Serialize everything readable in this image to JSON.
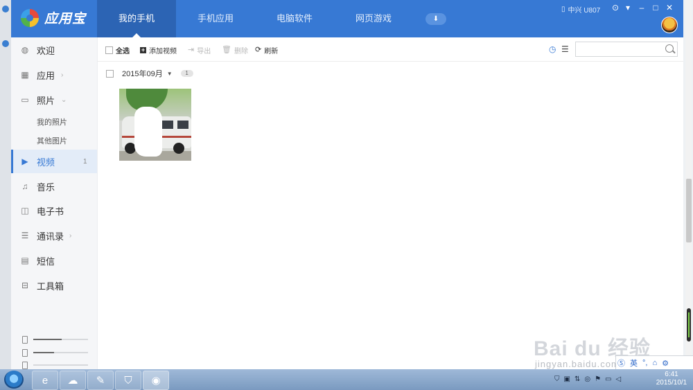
{
  "app": {
    "name": "应用宝",
    "tabs": [
      {
        "label": "我的手机"
      },
      {
        "label": "手机应用"
      },
      {
        "label": "电脑软件"
      },
      {
        "label": "网页游戏"
      }
    ],
    "device_name": "中兴 U807"
  },
  "sidebar": {
    "items": [
      {
        "label": "欢迎",
        "icon": "welcome-icon"
      },
      {
        "label": "应用",
        "icon": "apps-grid-icon"
      },
      {
        "label": "照片",
        "icon": "photo-icon"
      },
      {
        "label": "视频",
        "icon": "video-icon",
        "count": "1"
      },
      {
        "label": "音乐",
        "icon": "music-note-icon"
      },
      {
        "label": "电子书",
        "icon": "book-icon"
      },
      {
        "label": "通讯录",
        "icon": "contacts-icon"
      },
      {
        "label": "短信",
        "icon": "sms-icon"
      },
      {
        "label": "工具箱",
        "icon": "toolbox-icon"
      }
    ],
    "photo_sub": [
      "我的照片",
      "其他图片"
    ],
    "storage": [
      {
        "fill": 0.52
      },
      {
        "fill": 0.38
      },
      {
        "fill": 0.0
      }
    ]
  },
  "toolbar": {
    "select_all": "全选",
    "add_video": "添加视频",
    "export": "导出",
    "delete": "删除",
    "refresh": "刷新",
    "search_placeholder": ""
  },
  "content": {
    "group_label": "2015年09月",
    "group_count": "1"
  },
  "watermark": {
    "text": "Bai du 经验",
    "url": "jingyan.baidu.com"
  },
  "ime": {
    "mode": "英"
  },
  "taskbar": {
    "time": "6:41",
    "date": "2015/10/1"
  },
  "colors": {
    "header": "#3779d4",
    "active_tab": "#2c64b4",
    "accent": "#3779d4"
  }
}
